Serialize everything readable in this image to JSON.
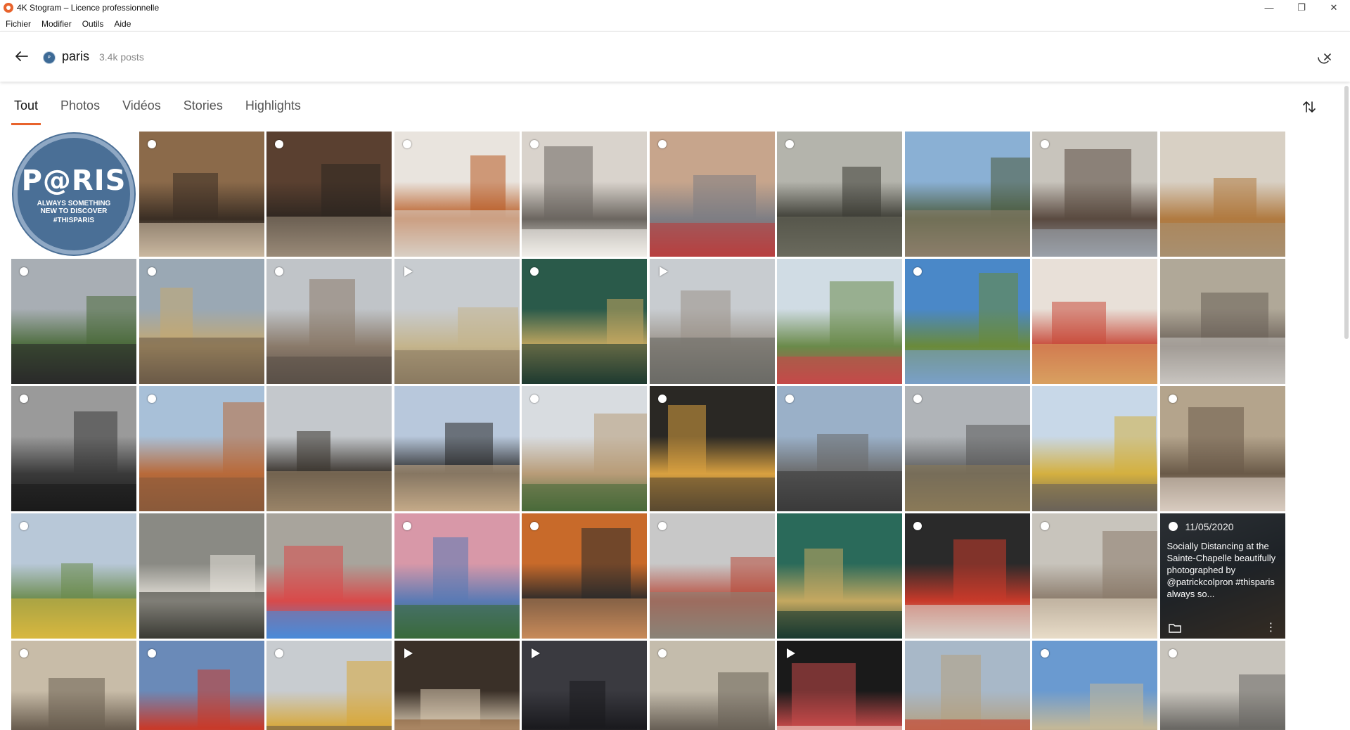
{
  "window": {
    "title": "4K Stogram – Licence professionnelle",
    "minimize": "—",
    "maximize": "❐",
    "close": "✕"
  },
  "menu": [
    "Fichier",
    "Modifier",
    "Outils",
    "Aide"
  ],
  "header": {
    "account_name": "paris",
    "post_count": "3.4k posts"
  },
  "tabs": [
    {
      "label": "Tout",
      "active": true
    },
    {
      "label": "Photos",
      "active": false
    },
    {
      "label": "Vidéos",
      "active": false
    },
    {
      "label": "Stories",
      "active": false
    },
    {
      "label": "Highlights",
      "active": false
    }
  ],
  "colors": {
    "accent": "#e8632c",
    "logo_blue": "#4a6f96"
  },
  "logo_tile": {
    "main": "P@RIS",
    "sub_line1": "ALWAYS SOMETHING",
    "sub_line2": "NEW TO DISCOVER",
    "hashtag": "#THISPARIS"
  },
  "overlay_tile": {
    "date": "11/05/2020",
    "caption": "Socially Distancing at the Sainte-Chapelle beautifully photographed by @patrickcolpron #thisparis always so..."
  },
  "tiles": [
    {
      "kind": "logo"
    },
    {
      "kind": "photo",
      "marker": "sel",
      "palette": [
        "#8b6a4a",
        "#3a2e24",
        "#c9b8a0"
      ]
    },
    {
      "kind": "photo",
      "marker": "sel",
      "palette": [
        "#5a4030",
        "#2e2620",
        "#9a8a78"
      ]
    },
    {
      "kind": "photo",
      "marker": "sel",
      "palette": [
        "#e9e4de",
        "#b85a22",
        "#d8cfc4"
      ]
    },
    {
      "kind": "photo",
      "marker": "sel",
      "palette": [
        "#d9d3cc",
        "#6b6660",
        "#f2efea"
      ]
    },
    {
      "kind": "photo",
      "marker": "sel",
      "palette": [
        "#c7a58c",
        "#7e7e84",
        "#b84040"
      ]
    },
    {
      "kind": "photo",
      "marker": "sel",
      "palette": [
        "#b4b4ac",
        "#3c3c34",
        "#6a6a5e"
      ]
    },
    {
      "kind": "photo",
      "marker": "none",
      "palette": [
        "#8ab0d4",
        "#4a5a3a",
        "#8c7e6a"
      ]
    },
    {
      "kind": "photo",
      "marker": "sel",
      "palette": [
        "#c8c4bc",
        "#5a4a40",
        "#9aa0a8"
      ]
    },
    {
      "kind": "photo",
      "marker": "none",
      "palette": [
        "#d8d0c4",
        "#b07a40",
        "#a89070"
      ]
    },
    {
      "kind": "photo",
      "marker": "sel",
      "palette": [
        "#a8aeb4",
        "#4a6a3a",
        "#2a2a2a"
      ]
    },
    {
      "kind": "photo",
      "marker": "sel",
      "palette": [
        "#9aa8b4",
        "#c4a870",
        "#6a5a48"
      ]
    },
    {
      "kind": "photo",
      "marker": "sel",
      "palette": [
        "#c0c4c8",
        "#8a7a6a",
        "#5a5048"
      ]
    },
    {
      "kind": "photo",
      "marker": "play",
      "palette": [
        "#c8ccd0",
        "#c4b48c",
        "#8a7a60"
      ]
    },
    {
      "kind": "photo",
      "marker": "sel",
      "palette": [
        "#2a5a4a",
        "#c4a860",
        "#1e3a30"
      ]
    },
    {
      "kind": "photo",
      "marker": "play",
      "palette": [
        "#c8ccd0",
        "#9a9288",
        "#6a6a66"
      ]
    },
    {
      "kind": "photo",
      "marker": "none",
      "palette": [
        "#d0dce4",
        "#6a8a4a",
        "#c44a4a"
      ]
    },
    {
      "kind": "photo",
      "marker": "sel",
      "palette": [
        "#4a88c8",
        "#6a8a3a",
        "#7aa0c8"
      ]
    },
    {
      "kind": "photo",
      "marker": "none",
      "palette": [
        "#e8e0d8",
        "#c84a3a",
        "#d8a060"
      ]
    },
    {
      "kind": "photo",
      "marker": "none",
      "palette": [
        "#b0a898",
        "#6a6058",
        "#c8c4c0"
      ]
    },
    {
      "kind": "photo",
      "marker": "sel",
      "palette": [
        "#9a9a9a",
        "#3a3a3a",
        "#1a1a1a"
      ]
    },
    {
      "kind": "photo",
      "marker": "sel",
      "palette": [
        "#a8c0d8",
        "#b86a3a",
        "#8a5a3a"
      ]
    },
    {
      "kind": "photo",
      "marker": "none",
      "palette": [
        "#c4c8cc",
        "#3a342e",
        "#9a8468"
      ]
    },
    {
      "kind": "photo",
      "marker": "none",
      "palette": [
        "#b8c8dc",
        "#2a2a2a",
        "#c4aa88"
      ]
    },
    {
      "kind": "photo",
      "marker": "sel",
      "palette": [
        "#d8dce0",
        "#b89c78",
        "#4a6a3a"
      ]
    },
    {
      "kind": "photo",
      "marker": "sel",
      "palette": [
        "#2a2824",
        "#d8a040",
        "#5a4a30"
      ]
    },
    {
      "kind": "photo",
      "marker": "sel",
      "palette": [
        "#9ab0c8",
        "#6a6a6a",
        "#3a3a3a"
      ]
    },
    {
      "kind": "photo",
      "marker": "sel",
      "palette": [
        "#b0b4b8",
        "#5a5a5a",
        "#8a7a58"
      ]
    },
    {
      "kind": "photo",
      "marker": "none",
      "palette": [
        "#c8d8e8",
        "#d4b040",
        "#6a6258"
      ]
    },
    {
      "kind": "photo",
      "marker": "sel",
      "palette": [
        "#b4a48c",
        "#6a5a48",
        "#d8ccc0"
      ]
    },
    {
      "kind": "photo",
      "marker": "sel",
      "palette": [
        "#b8c8d8",
        "#6a8a4a",
        "#d8b840"
      ]
    },
    {
      "kind": "photo",
      "marker": "none",
      "palette": [
        "#8a8a84",
        "#e8e4dc",
        "#3a3a34"
      ]
    },
    {
      "kind": "photo",
      "marker": "none",
      "palette": [
        "#a8a49c",
        "#d84a4a",
        "#4a8ad8"
      ]
    },
    {
      "kind": "photo",
      "marker": "sel",
      "palette": [
        "#d898a8",
        "#5a7ab4",
        "#3a6a3a"
      ]
    },
    {
      "kind": "photo",
      "marker": "sel",
      "palette": [
        "#c86a2a",
        "#2a2a2a",
        "#c88a5a"
      ]
    },
    {
      "kind": "photo",
      "marker": "sel",
      "palette": [
        "#c8c8c8",
        "#b84a3a",
        "#8a8478"
      ]
    },
    {
      "kind": "photo",
      "marker": "none",
      "palette": [
        "#2a6a5a",
        "#c4a860",
        "#1a3a30"
      ]
    },
    {
      "kind": "photo",
      "marker": "sel",
      "palette": [
        "#2a2a2a",
        "#c83a2a",
        "#d8d0c8"
      ]
    },
    {
      "kind": "photo",
      "marker": "sel",
      "palette": [
        "#c8c4bc",
        "#8a7a6a",
        "#e8dcc8"
      ]
    },
    {
      "kind": "overlay"
    },
    {
      "kind": "photo",
      "marker": "sel",
      "palette": [
        "#c8bca8",
        "#6a5e50",
        "#3a342c"
      ]
    },
    {
      "kind": "photo",
      "marker": "sel",
      "palette": [
        "#6a8ab8",
        "#c83a2a",
        "#8a7a60"
      ]
    },
    {
      "kind": "photo",
      "marker": "sel",
      "palette": [
        "#c8ccd0",
        "#d8a838",
        "#6a5a48"
      ]
    },
    {
      "kind": "photo",
      "marker": "play",
      "palette": [
        "#3a3028",
        "#d8c8b0",
        "#8a5a30"
      ]
    },
    {
      "kind": "photo",
      "marker": "play",
      "palette": [
        "#3a3a40",
        "#1a1a1e",
        "#d8d0a8"
      ]
    },
    {
      "kind": "photo",
      "marker": "sel",
      "palette": [
        "#c4bcac",
        "#6a6258",
        "#3a342e"
      ]
    },
    {
      "kind": "photo",
      "marker": "play",
      "palette": [
        "#1a1a1a",
        "#c84a4a",
        "#f0d8d0"
      ]
    },
    {
      "kind": "photo",
      "marker": "none",
      "palette": [
        "#a8b8c8",
        "#b4a080",
        "#c83a2a"
      ]
    },
    {
      "kind": "photo",
      "marker": "sel",
      "palette": [
        "#6a9ad0",
        "#c4b898",
        "#5a5048"
      ]
    },
    {
      "kind": "photo",
      "marker": "sel",
      "palette": [
        "#c8c4bc",
        "#6a6864",
        "#9a948a"
      ]
    }
  ]
}
